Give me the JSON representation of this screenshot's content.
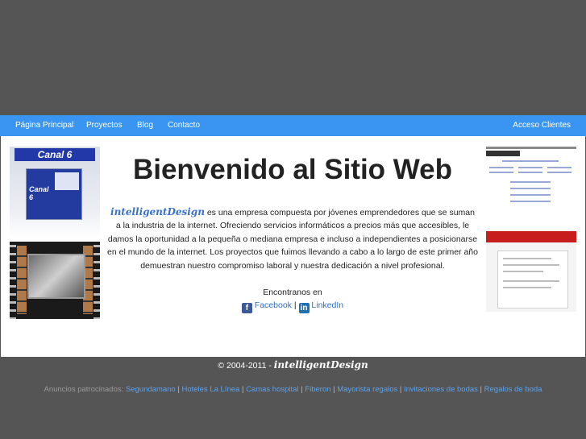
{
  "nav": {
    "items": [
      {
        "label": "Página Principal"
      },
      {
        "label": "Proyectos"
      },
      {
        "label": "Blog"
      },
      {
        "label": "Contacto"
      }
    ],
    "client_access": "Acceso Clientes"
  },
  "main": {
    "title": "Bienvenido al Sitio Web",
    "brand": "intelligentDesign",
    "intro_text": "es una empresa compuesta por jóvenes emprendedores que se suman a la industria de la internet. Ofreciendo servicios informáticos a precios más que accesibles, le damos la oportunidad a la pequeña o mediana empresa e incluso a independientes a posicionarse en el mundo de la internet. Los proyectos que fuimos llevando a cabo a lo largo de este primer año demuestran nuestro compromiso laboral y nuestra dedicación a nivel profesional.",
    "find_us": "Encontranos en",
    "facebook": "Facebook",
    "separator": "|",
    "linkedin": "LinkedIn"
  },
  "thumbnails": {
    "canal6_banner": "Canal 6",
    "canal6_inner": "Canal 6"
  },
  "footer": {
    "copyright": "© 2004-2011 -",
    "brand": "intelligentDesign"
  },
  "ads": {
    "label": "Anuncios patrocinados:",
    "links": [
      {
        "label": "Segundamano"
      },
      {
        "label": "Hoteles La Línea"
      },
      {
        "label": "Camas hospital"
      },
      {
        "label": "Fiberon"
      },
      {
        "label": "Mayorista regalos"
      },
      {
        "label": "Invitaciones de bodas"
      },
      {
        "label": "Regalos de boda"
      }
    ]
  },
  "colors": {
    "background": "#555555",
    "navbar": "#3a95f2",
    "link": "#2f6fc4"
  },
  "icons": {
    "facebook": "facebook-icon",
    "linkedin": "linkedin-icon"
  }
}
